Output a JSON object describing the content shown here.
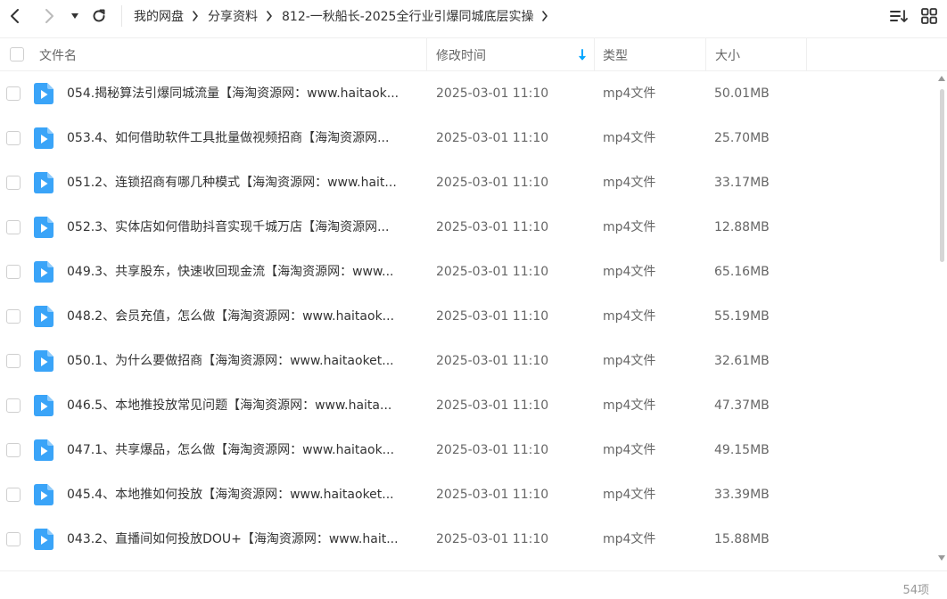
{
  "breadcrumb": [
    "我的网盘",
    "分享资料",
    "812-一秋船长-2025全行业引爆同城底层实操"
  ],
  "columns": {
    "name": "文件名",
    "modified": "修改时间",
    "type": "类型",
    "size": "大小"
  },
  "colors": {
    "accent": "#06a7ff",
    "icon": "#3aa4f8"
  },
  "files": [
    {
      "name": "054.揭秘算法引爆同城流量【海淘资源网：www.haitaok...",
      "modified": "2025-03-01 11:10",
      "type": "mp4文件",
      "size": "50.01MB"
    },
    {
      "name": "053.4、如何借助软件工具批量做视频招商【海淘资源网...",
      "modified": "2025-03-01 11:10",
      "type": "mp4文件",
      "size": "25.70MB"
    },
    {
      "name": "051.2、连锁招商有哪几种模式【海淘资源网：www.hait...",
      "modified": "2025-03-01 11:10",
      "type": "mp4文件",
      "size": "33.17MB"
    },
    {
      "name": "052.3、实体店如何借助抖音实现千城万店【海淘资源网...",
      "modified": "2025-03-01 11:10",
      "type": "mp4文件",
      "size": "12.88MB"
    },
    {
      "name": "049.3、共享股东，快速收回现金流【海淘资源网：www...",
      "modified": "2025-03-01 11:10",
      "type": "mp4文件",
      "size": "65.16MB"
    },
    {
      "name": "048.2、会员充值，怎么做【海淘资源网：www.haitaok...",
      "modified": "2025-03-01 11:10",
      "type": "mp4文件",
      "size": "55.19MB"
    },
    {
      "name": "050.1、为什么要做招商【海淘资源网：www.haitaoket...",
      "modified": "2025-03-01 11:10",
      "type": "mp4文件",
      "size": "32.61MB"
    },
    {
      "name": "046.5、本地推投放常见问题【海淘资源网：www.haita...",
      "modified": "2025-03-01 11:10",
      "type": "mp4文件",
      "size": "47.37MB"
    },
    {
      "name": "047.1、共享爆品，怎么做【海淘资源网：www.haitaok...",
      "modified": "2025-03-01 11:10",
      "type": "mp4文件",
      "size": "49.15MB"
    },
    {
      "name": "045.4、本地推如何投放【海淘资源网：www.haitaoket...",
      "modified": "2025-03-01 11:10",
      "type": "mp4文件",
      "size": "33.39MB"
    },
    {
      "name": "043.2、直播间如何投放DOU+【海淘资源网：www.hait...",
      "modified": "2025-03-01 11:10",
      "type": "mp4文件",
      "size": "15.88MB"
    }
  ],
  "footer": {
    "count": "54项"
  }
}
